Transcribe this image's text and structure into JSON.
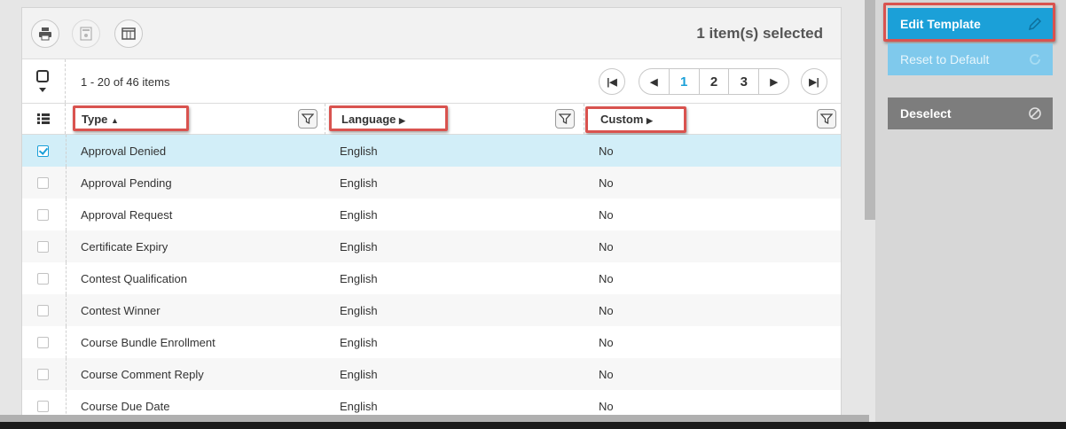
{
  "toolbar": {
    "icons": [
      "print-icon",
      "export-icon",
      "columns-icon"
    ],
    "selected_text": "1 item(s) selected"
  },
  "pager": {
    "items_text": "1 - 20 of 46 items",
    "pages": [
      "1",
      "2",
      "3"
    ],
    "active_page": "1"
  },
  "columns": [
    {
      "label": "Type",
      "sort": "ascending"
    },
    {
      "label": "Language",
      "sort": "none"
    },
    {
      "label": "Custom",
      "sort": "none"
    }
  ],
  "rows": [
    {
      "type": "Approval Denied",
      "language": "English",
      "custom": "No",
      "selected": true
    },
    {
      "type": "Approval Pending",
      "language": "English",
      "custom": "No",
      "selected": false
    },
    {
      "type": "Approval Request",
      "language": "English",
      "custom": "No",
      "selected": false
    },
    {
      "type": "Certificate Expiry",
      "language": "English",
      "custom": "No",
      "selected": false
    },
    {
      "type": "Contest Qualification",
      "language": "English",
      "custom": "No",
      "selected": false
    },
    {
      "type": "Contest Winner",
      "language": "English",
      "custom": "No",
      "selected": false
    },
    {
      "type": "Course Bundle Enrollment",
      "language": "English",
      "custom": "No",
      "selected": false
    },
    {
      "type": "Course Comment Reply",
      "language": "English",
      "custom": "No",
      "selected": false
    },
    {
      "type": "Course Due Date",
      "language": "English",
      "custom": "No",
      "selected": false
    }
  ],
  "sidebar": {
    "edit_label": "Edit Template",
    "reset_label": "Reset to Default",
    "deselect_label": "Deselect"
  },
  "colors": {
    "accent": "#1ba0d8",
    "highlight_border": "#d9534f",
    "selected_row": "#d2eef8"
  }
}
